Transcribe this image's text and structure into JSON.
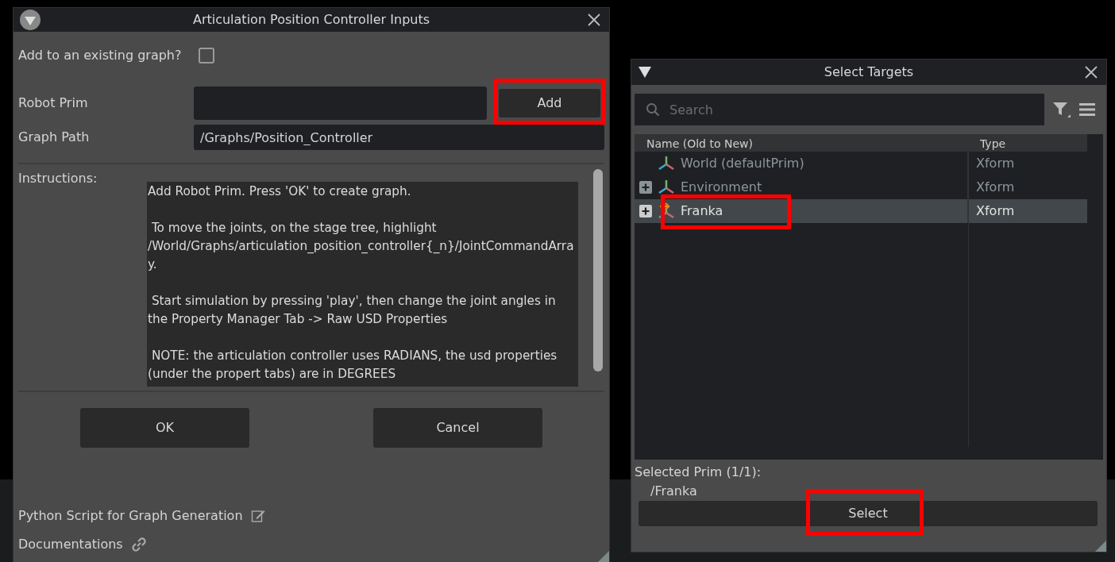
{
  "controller_dialog": {
    "title": "Articulation Position Controller Inputs",
    "existing_graph": {
      "label": "Add to an existing graph?",
      "checked": false
    },
    "robot_prim": {
      "label": "Robot Prim",
      "button": {
        "label": "Add",
        "highlighted": true
      }
    },
    "graph_path": {
      "label": "Graph Path",
      "value": "/Graphs/Position_Controller"
    },
    "instructions": {
      "label": "Instructions:",
      "paragraphs": [
        "Add Robot Prim. Press 'OK' to create graph.",
        " To move the joints, on the stage tree, highlight /World/Graphs/articulation_position_controller{_n}/JointCommandArray.",
        " Start simulation by pressing 'play', then change the joint angles in the Property Manager Tab -> Raw USD Properties",
        " NOTE: the articulation controller uses RADIANS, the usd properties (under the propert tabs) are in DEGREES"
      ]
    },
    "buttons": [
      "OK",
      "Cancel"
    ],
    "links": [
      {
        "label": "Python Script for Graph Generation",
        "kind": "edit"
      },
      {
        "label": "Documentations",
        "kind": "link"
      }
    ]
  },
  "targets_dialog": {
    "title": "Select Targets",
    "search": {
      "placeholder": "Search"
    },
    "columns": [
      "Name (Old to New)",
      "Type"
    ],
    "rows": [
      {
        "name": "World (defaultPrim)",
        "type": "Xform",
        "expandable": false,
        "selected": false,
        "highlighted": false,
        "kind": "xform"
      },
      {
        "name": "Environment",
        "type": "Xform",
        "expandable": true,
        "selected": false,
        "highlighted": false,
        "kind": "xform"
      },
      {
        "name": "Franka",
        "type": "Xform",
        "expandable": true,
        "selected": true,
        "highlighted": true,
        "kind": "articulation"
      }
    ],
    "selected_label": "Selected Prim (1/1):",
    "selected_path": "/Franka",
    "button": {
      "label": "Select",
      "highlighted": true
    }
  }
}
